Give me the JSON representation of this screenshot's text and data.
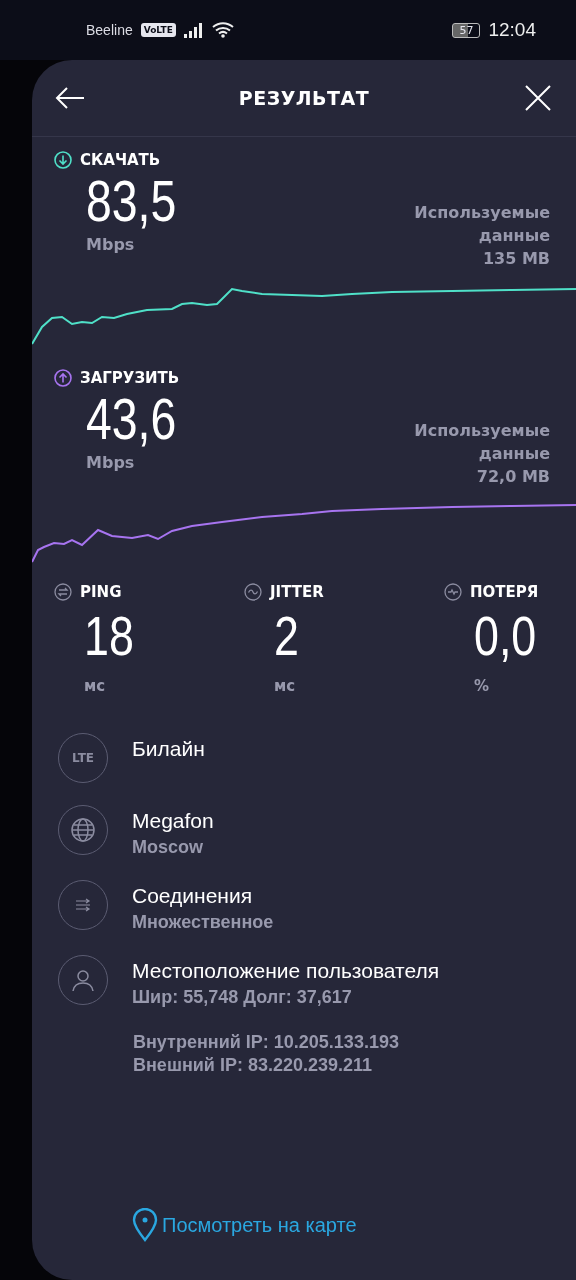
{
  "status_bar": {
    "carrier": "Beeline",
    "network_badge": "VoLTE",
    "battery": "57",
    "time": "12:04"
  },
  "header": {
    "title": "РЕЗУЛЬТАТ"
  },
  "speeds": [
    {
      "kind": "download",
      "label": "СКАЧАТЬ",
      "value": "83,5",
      "unit": "Mbps",
      "data_label": "Используемые данные",
      "data_value": "135 MB",
      "color": "#4fe0c8"
    },
    {
      "kind": "upload",
      "label": "ЗАГРУЗИТЬ",
      "value": "43,6",
      "unit": "Mbps",
      "data_label": "Используемые данные",
      "data_value": "72,0 MB",
      "color": "#a774f0"
    }
  ],
  "metrics": [
    {
      "kind": "ping",
      "label": "PING",
      "value": "18",
      "unit": "мс"
    },
    {
      "kind": "jitter",
      "label": "JITTER",
      "value": "2",
      "unit": "мс"
    },
    {
      "kind": "loss",
      "label": "ПОТЕРЯ",
      "value": "0,0",
      "unit": "%"
    }
  ],
  "details": [
    {
      "kind": "lte",
      "badge": "LTE",
      "title": "Билайн"
    },
    {
      "kind": "globe",
      "title": "Megafon",
      "subtitle": "Moscow"
    },
    {
      "kind": "connections",
      "title": "Соединения",
      "subtitle": "Множественное"
    },
    {
      "kind": "user",
      "title": "Местоположение пользователя",
      "subtitle": "Шир: 55,748 Долг: 37,617"
    }
  ],
  "ip_lines": [
    "Внутренний IP: 10.205.133.193",
    "Внешний IP: 83.220.239.211"
  ],
  "map_link": "Посмотреть на карте"
}
